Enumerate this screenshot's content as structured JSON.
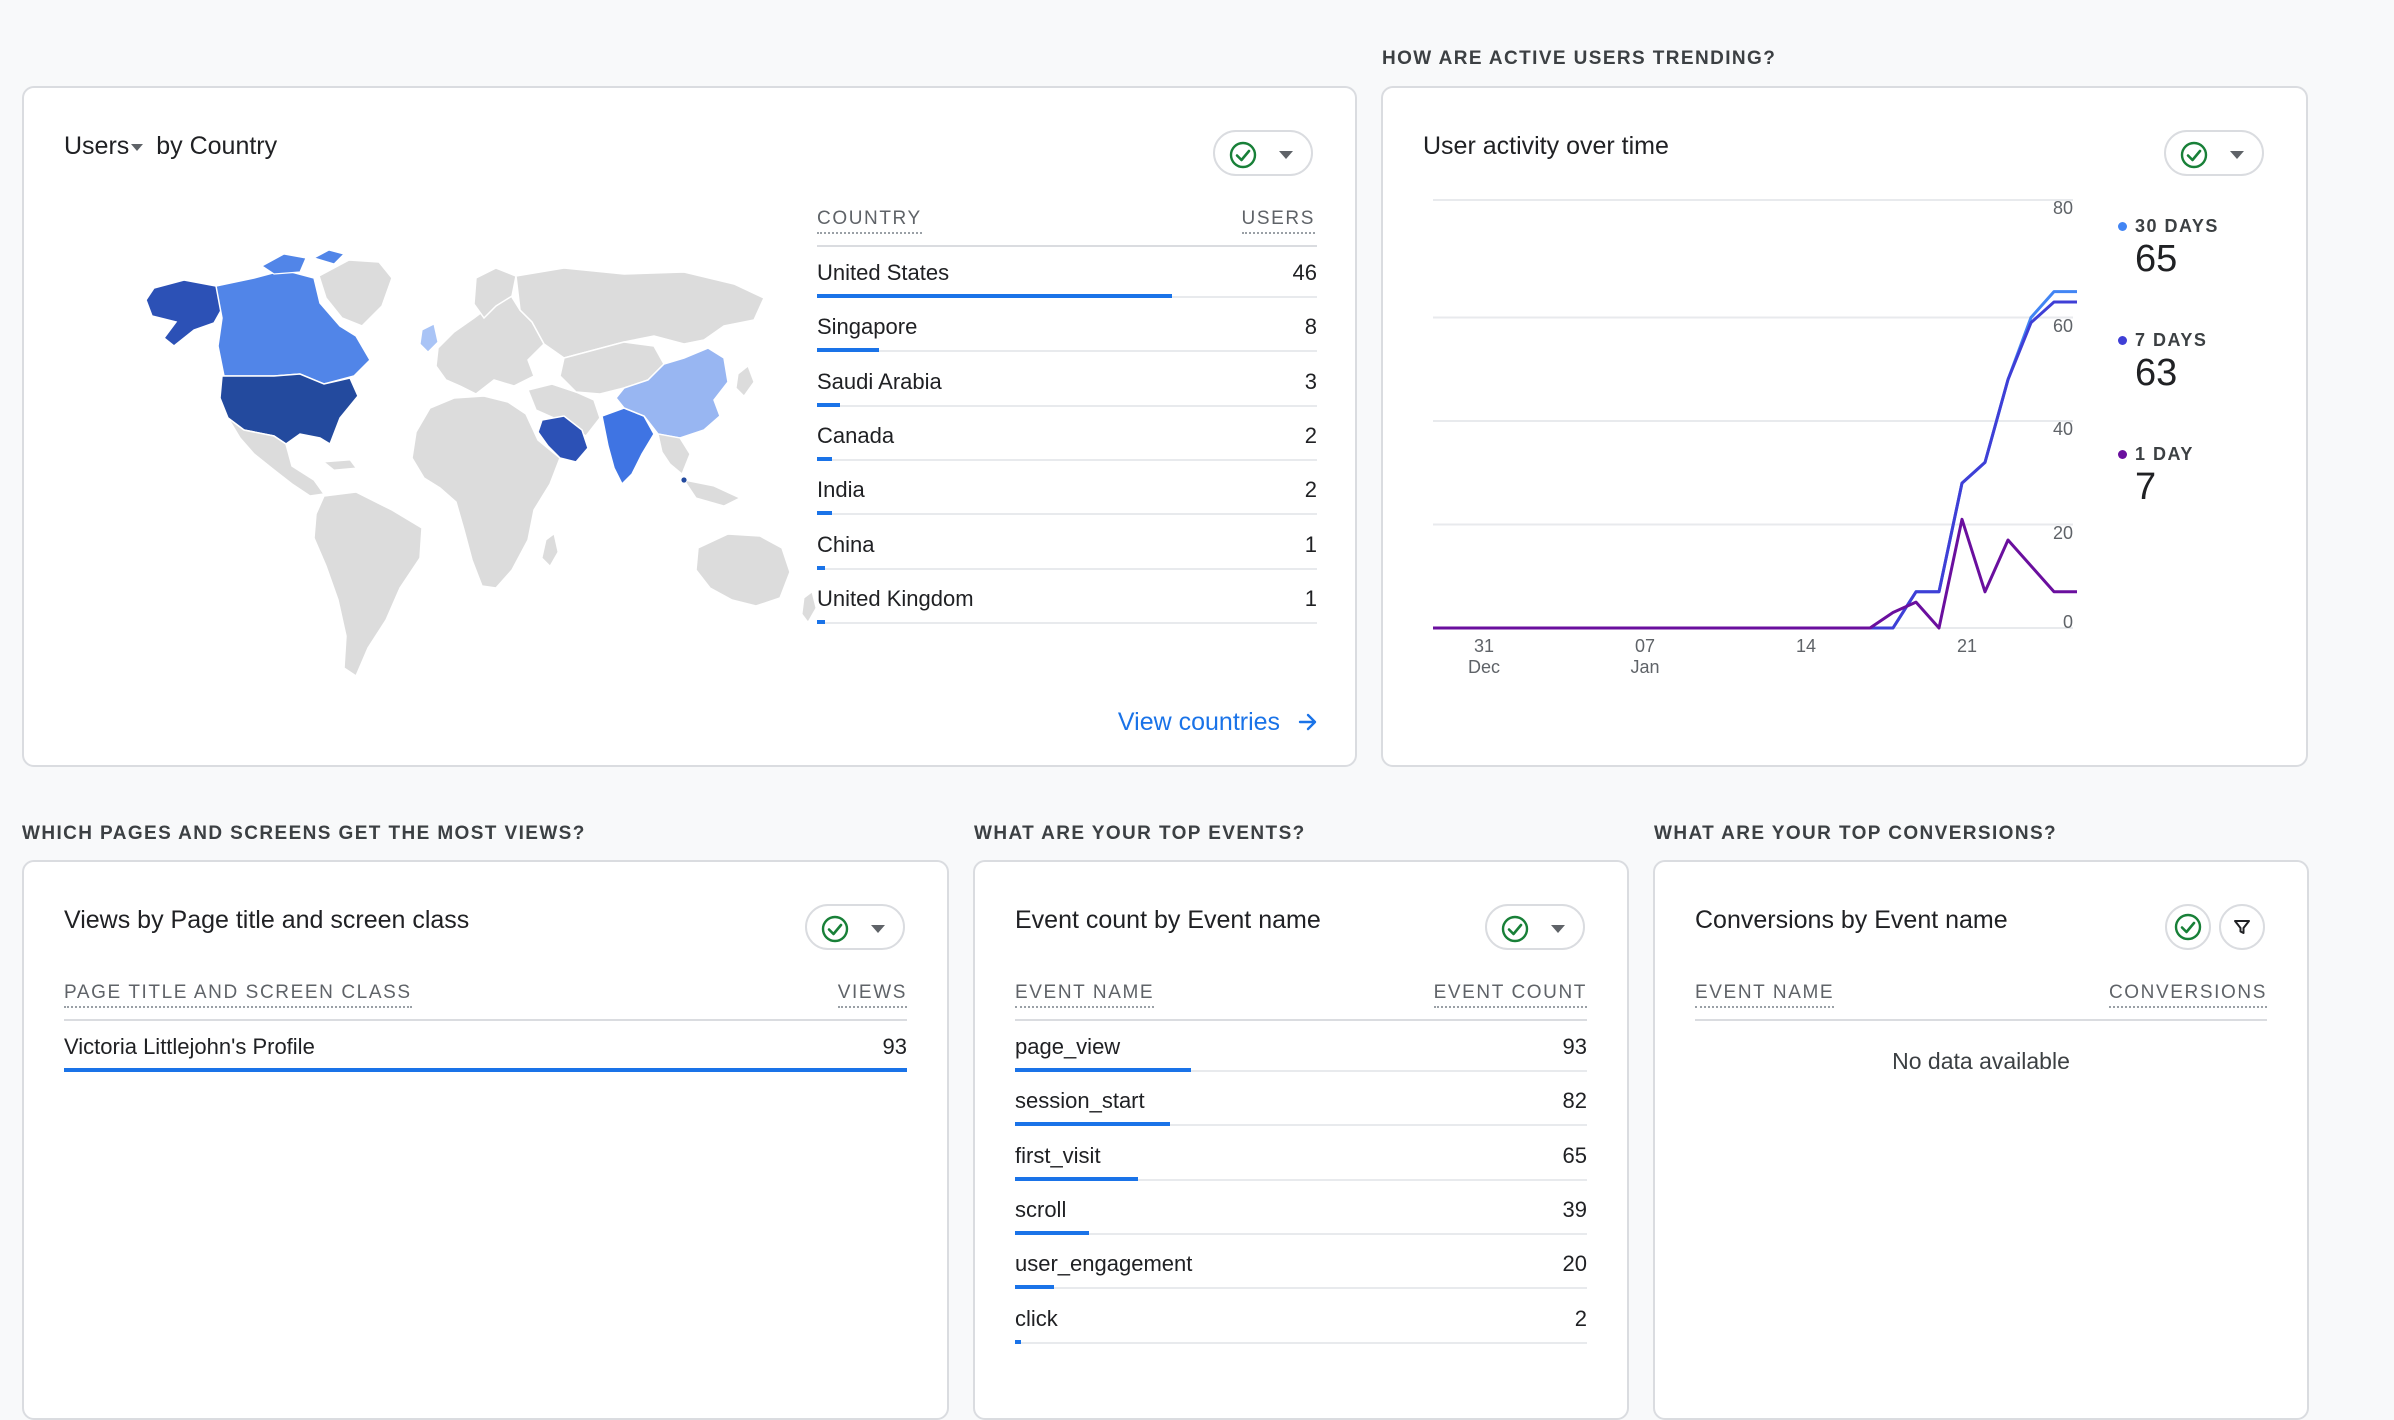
{
  "sections": {
    "trend": "HOW ARE ACTIVE USERS TRENDING?",
    "pages": "WHICH PAGES AND SCREENS GET THE MOST VIEWS?",
    "events": "WHAT ARE YOUR TOP EVENTS?",
    "conversions": "WHAT ARE YOUR TOP CONVERSIONS?"
  },
  "colors": {
    "accent": "#1a73e8",
    "success": "#188038",
    "series_30d": "#4285f4",
    "series_7d": "#3f3fd6",
    "series_1d": "#6a0f9e"
  },
  "country_card": {
    "title_metric": "Users",
    "title_rest": "by Country",
    "col_country": "COUNTRY",
    "col_users": "USERS",
    "rows": [
      {
        "name": "United States",
        "value": "46",
        "share": 1.0
      },
      {
        "name": "Singapore",
        "value": "8",
        "share": 0.174
      },
      {
        "name": "Saudi Arabia",
        "value": "3",
        "share": 0.065
      },
      {
        "name": "Canada",
        "value": "2",
        "share": 0.043
      },
      {
        "name": "India",
        "value": "2",
        "share": 0.043
      },
      {
        "name": "China",
        "value": "1",
        "share": 0.022
      },
      {
        "name": "United Kingdom",
        "value": "1",
        "share": 0.022
      }
    ],
    "link": "View countries"
  },
  "activity_card": {
    "title": "User activity over time",
    "legend": [
      {
        "label": "30 DAYS",
        "value": "65",
        "color": "#4285f4"
      },
      {
        "label": "7 DAYS",
        "value": "63",
        "color": "#3f3fd6"
      },
      {
        "label": "1 DAY",
        "value": "7",
        "color": "#6a0f9e"
      }
    ],
    "y_ticks": [
      "80",
      "60",
      "40",
      "20",
      "0"
    ],
    "x_ticks": [
      {
        "day": "31",
        "month": "Dec"
      },
      {
        "day": "07",
        "month": "Jan"
      },
      {
        "day": "14",
        "month": ""
      },
      {
        "day": "21",
        "month": ""
      }
    ]
  },
  "chart_data": {
    "type": "line",
    "x": [
      "Dec 29",
      "Dec 30",
      "Dec 31",
      "Jan 1",
      "Jan 2",
      "Jan 3",
      "Jan 4",
      "Jan 5",
      "Jan 6",
      "Jan 7",
      "Jan 8",
      "Jan 9",
      "Jan 10",
      "Jan 11",
      "Jan 12",
      "Jan 13",
      "Jan 14",
      "Jan 15",
      "Jan 16",
      "Jan 17",
      "Jan 18",
      "Jan 19",
      "Jan 20",
      "Jan 21",
      "Jan 22",
      "Jan 23",
      "Jan 24",
      "Jan 25",
      "Jan 26"
    ],
    "series": [
      {
        "name": "30 DAYS",
        "values": [
          0,
          0,
          0,
          0,
          0,
          0,
          0,
          0,
          0,
          0,
          0,
          0,
          0,
          0,
          0,
          0,
          0,
          0,
          0,
          0,
          0,
          7,
          7,
          28,
          32,
          48,
          60,
          65,
          65
        ]
      },
      {
        "name": "7 DAYS",
        "values": [
          0,
          0,
          0,
          0,
          0,
          0,
          0,
          0,
          0,
          0,
          0,
          0,
          0,
          0,
          0,
          0,
          0,
          0,
          0,
          0,
          0,
          7,
          7,
          28,
          32,
          48,
          59,
          63,
          63
        ]
      },
      {
        "name": "1 DAY",
        "values": [
          0,
          0,
          0,
          0,
          0,
          0,
          0,
          0,
          0,
          0,
          0,
          0,
          0,
          0,
          0,
          0,
          0,
          0,
          0,
          0,
          3,
          5,
          0,
          21,
          7,
          17,
          12,
          7,
          7
        ]
      }
    ],
    "ylim": [
      0,
      80
    ]
  },
  "pages_card": {
    "title": "Views by Page title and screen class",
    "col_name": "PAGE TITLE AND SCREEN CLASS",
    "col_value": "VIEWS",
    "rows": [
      {
        "name": "Victoria Littlejohn's Profile",
        "value": "93",
        "share": 1.0
      }
    ]
  },
  "events_card": {
    "title": "Event count by Event name",
    "col_name": "EVENT NAME",
    "col_value": "EVENT COUNT",
    "rows": [
      {
        "name": "page_view",
        "value": "93",
        "share": 1.0
      },
      {
        "name": "session_start",
        "value": "82",
        "share": 0.88
      },
      {
        "name": "first_visit",
        "value": "65",
        "share": 0.7
      },
      {
        "name": "scroll",
        "value": "39",
        "share": 0.42
      },
      {
        "name": "user_engagement",
        "value": "20",
        "share": 0.22
      },
      {
        "name": "click",
        "value": "2",
        "share": 0.02
      }
    ]
  },
  "conversions_card": {
    "title": "Conversions by Event name",
    "col_name": "EVENT NAME",
    "col_value": "CONVERSIONS",
    "empty": "No data available"
  }
}
